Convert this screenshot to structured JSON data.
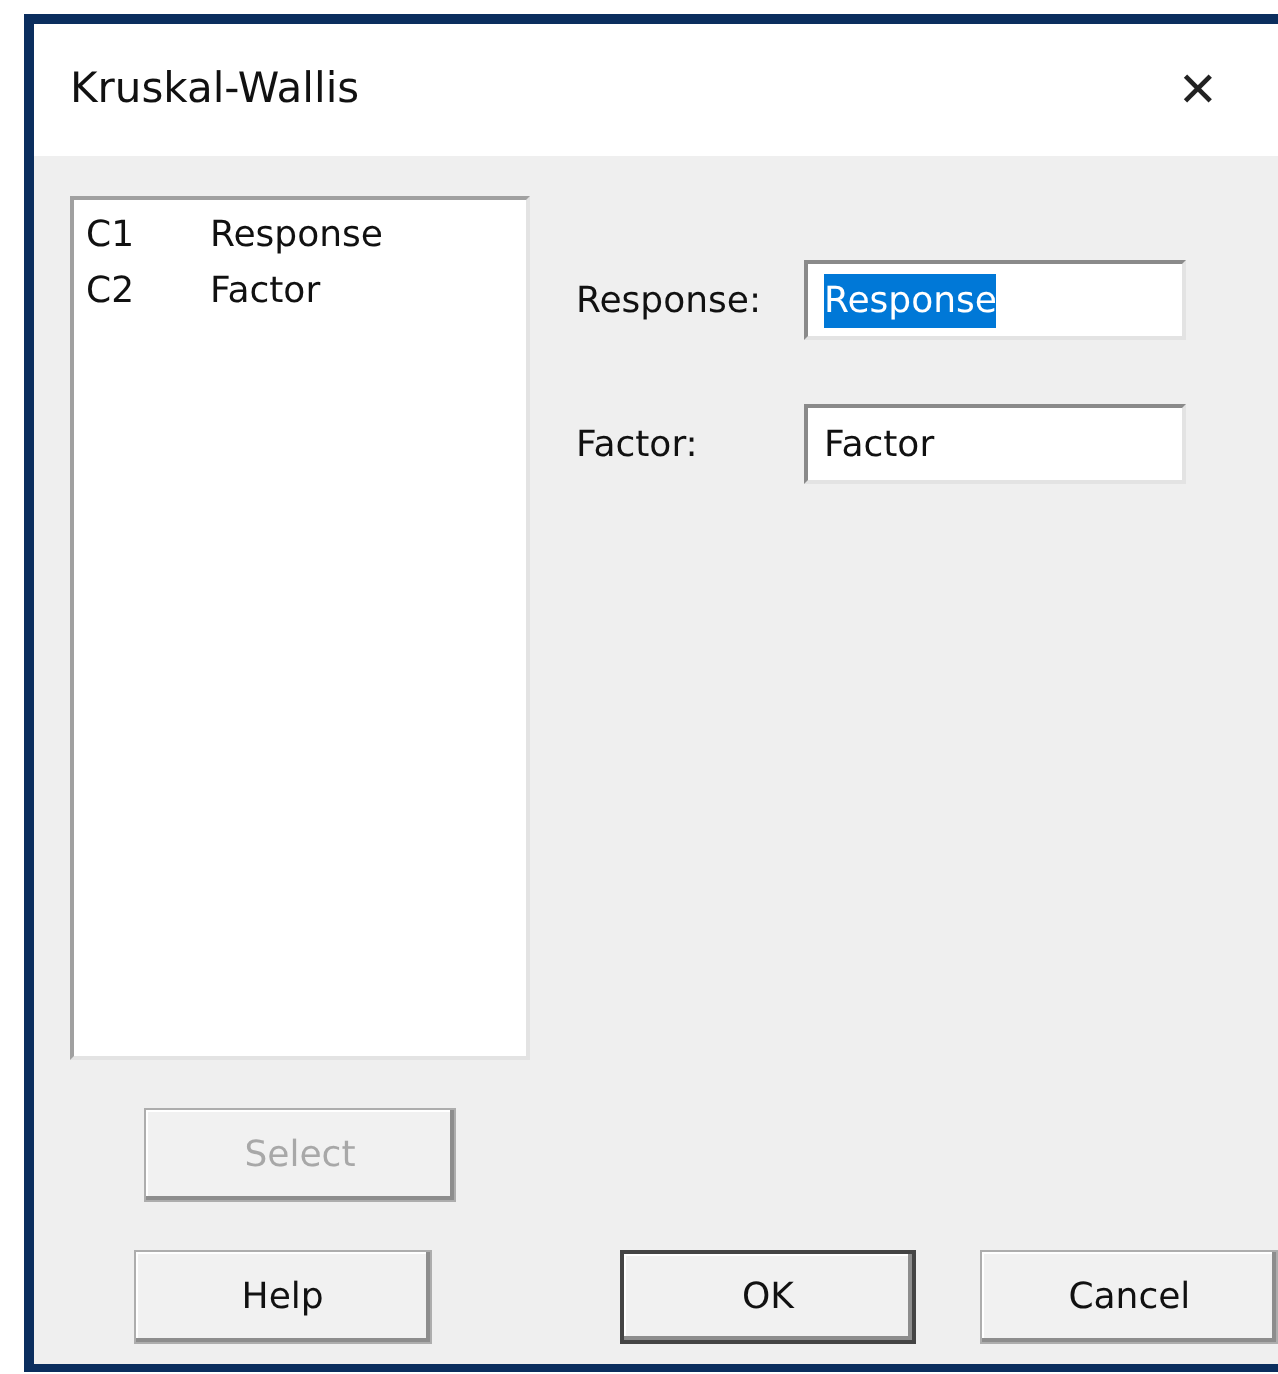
{
  "window": {
    "title": "Kruskal-Wallis",
    "close": "✕"
  },
  "columns": [
    {
      "id": "C1",
      "name": "Response"
    },
    {
      "id": "C2",
      "name": "Factor"
    }
  ],
  "fields": [
    {
      "label": "Response:",
      "value": "Response",
      "text_selected": true
    },
    {
      "label": "Factor:",
      "value": "Factor",
      "text_selected": false
    }
  ],
  "select_button": {
    "label": "Select",
    "disabled": true
  },
  "buttons": [
    {
      "label": "Help",
      "default": false
    },
    {
      "label": "OK",
      "default": true
    },
    {
      "label": "Cancel",
      "default": false
    }
  ]
}
